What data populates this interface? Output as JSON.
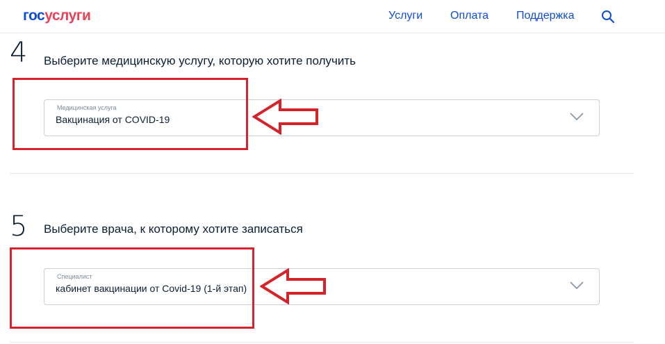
{
  "header": {
    "logo_part1": "гос",
    "logo_part2": "услуги",
    "nav": [
      "Услуги",
      "Оплата",
      "Поддержка"
    ],
    "search_icon": "search-icon"
  },
  "colors": {
    "brand_blue": "#0d4cd3",
    "brand_red": "#ee3f58",
    "annotation_red": "#d6232b"
  },
  "steps": [
    {
      "number": "4",
      "title": "Выберите медицинскую услугу, которую хотите получить",
      "field_label": "Медицинская услуга",
      "field_value": "Вакцинация от COVID-19"
    },
    {
      "number": "5",
      "title": "Выберите врача, к которому хотите записаться",
      "field_label": "Специалист",
      "field_value": "кабинет вакцинации от Covid-19 (1-й этап)"
    }
  ]
}
